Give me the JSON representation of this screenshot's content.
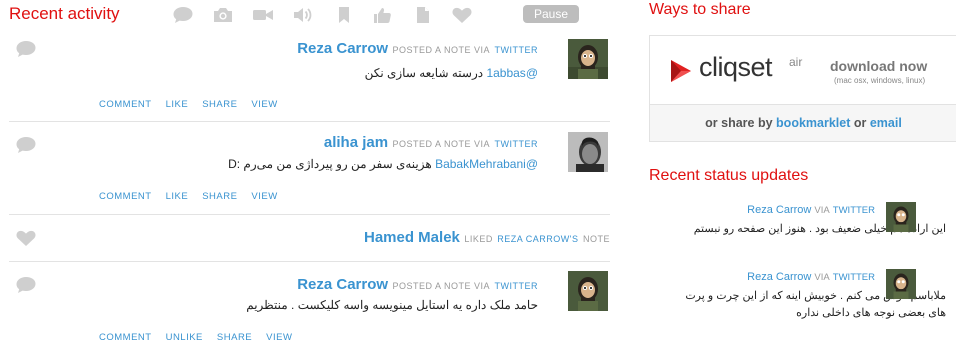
{
  "activity": {
    "title": "Recent activity",
    "pause_label": "Pause",
    "filters": [
      "comment-icon",
      "camera-icon",
      "video-icon",
      "audio-icon",
      "bookmark-icon",
      "thumbs-up-icon",
      "document-icon",
      "heart-icon"
    ],
    "items": [
      {
        "name": "Reza Carrow",
        "action": "POSTED A NOTE VIA",
        "source": "TWITTER",
        "mention": "@1abbas",
        "text": "درسته شایعه سازی نکن",
        "actions": [
          "COMMENT",
          "LIKE",
          "SHARE",
          "VIEW"
        ]
      },
      {
        "name": "aliha jam",
        "action": "POSTED A NOTE VIA",
        "source": "TWITTER",
        "mention": "@BabakMehrabani",
        "text": "هزینه‌ی سفر من رو پیرداژی من می‌رم :D",
        "actions": [
          "COMMENT",
          "LIKE",
          "SHARE",
          "VIEW"
        ]
      },
      {
        "name": "Hamed Malek",
        "action": "LIKED",
        "target": "REZA CARROW'S",
        "suffix": "NOTE"
      },
      {
        "name": "Reza Carrow",
        "action": "POSTED A NOTE VIA",
        "source": "TWITTER",
        "text": "حامد ملک داره یه استایل مینویسه واسه کلیکست . منتظریم",
        "actions": [
          "COMMENT",
          "UNLIKE",
          "SHARE",
          "VIEW"
        ]
      }
    ]
  },
  "share": {
    "title": "Ways to share",
    "logo_text": "cliqset",
    "logo_sup": "air",
    "download_label": "download now",
    "download_sub": "(mac osx, windows, linux)",
    "or_share_prefix": "or share by",
    "bookmarklet": "bookmarklet",
    "or_word": "or",
    "email": "email"
  },
  "status": {
    "title": "Recent status updates",
    "items": [
      {
        "name": "Reza Carrow",
        "via": "VIA",
        "source": "TWITTER",
        "text": "این اراده هم خیلی ضعیف بود . هنوز این صفحه رو نبستم"
      },
      {
        "name": "Reza Carrow",
        "via": "VIA",
        "source": "TWITTER",
        "text": "ملاباسم گوش می کنم . خوبیش اینه که از این چرت و پرت های بعضی نوجه های داخلی نداره"
      }
    ]
  },
  "colors": {
    "accent_red": "#e01010",
    "link_blue": "#3a93d0",
    "icon_gray": "#cfcfcf"
  }
}
